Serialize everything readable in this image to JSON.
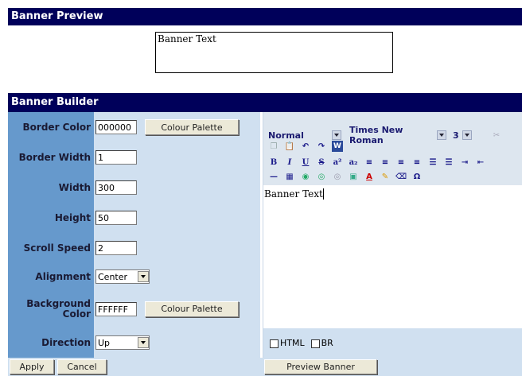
{
  "preview": {
    "title": "Banner Preview",
    "banner_text": "Banner Text"
  },
  "builder": {
    "title": "Banner Builder",
    "fields": {
      "border_color": {
        "label": "Border Color",
        "value": "000000",
        "palette_button": "Colour Palette"
      },
      "border_width": {
        "label": "Border Width",
        "value": "1"
      },
      "width": {
        "label": "Width",
        "value": "300"
      },
      "height": {
        "label": "Height",
        "value": "50"
      },
      "scroll_speed": {
        "label": "Scroll Speed",
        "value": "2"
      },
      "alignment": {
        "label": "Alignment",
        "value": "Center"
      },
      "background_color": {
        "label": "Background Color",
        "value": "FFFFFF",
        "palette_button": "Colour Palette"
      },
      "direction": {
        "label": "Direction",
        "value": "Up"
      }
    },
    "apply_label": "Apply",
    "cancel_label": "Cancel",
    "preview_banner_label": "Preview Banner"
  },
  "editor": {
    "style_select": "Normal",
    "font_select": "Times New Roman",
    "size_select": "3",
    "content": "Banner Text",
    "html_checkbox": "HTML",
    "br_checkbox": "BR"
  },
  "colors": {
    "header_bg": "#00005a",
    "label_bg": "#6699cc",
    "field_bg": "#d0e0f0"
  }
}
